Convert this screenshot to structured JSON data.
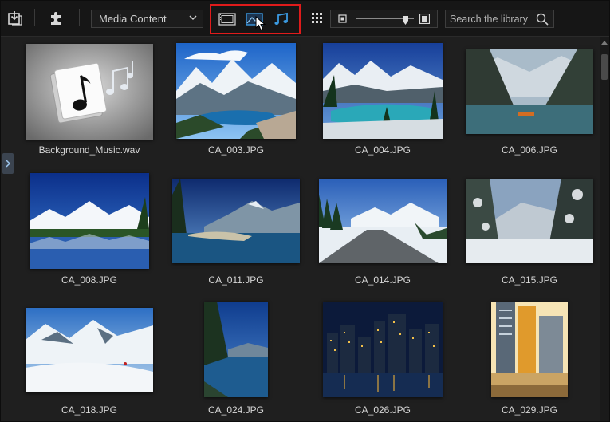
{
  "toolbar": {
    "icons": {
      "import": "import-media-icon",
      "plugin": "puzzle-plugin-icon",
      "dropdown_chevron": "chevron-down-icon",
      "filter_video": "film-filter-icon",
      "filter_image": "image-filter-icon",
      "filter_audio": "music-filter-icon",
      "grid": "grid-view-icon",
      "zoom_small": "zoom-small-icon",
      "zoom_large": "zoom-large-icon",
      "search": "magnifier-icon",
      "cursor": "mouse-pointer-icon"
    },
    "content_dropdown": {
      "selected": "Media Content"
    },
    "search": {
      "placeholder": "Search the library",
      "value": ""
    },
    "zoom_slider": {
      "level": 0.85
    },
    "active_filter": "image"
  },
  "colors": {
    "accent_blue": "#3b9ae1",
    "highlight_red": "#e01b1b",
    "panel_bg": "#1f1f1f",
    "toolbar_bg": "#161616",
    "label_text": "#d6d6d6"
  },
  "sidebar": {
    "expand_icon": "chevron-right-icon"
  },
  "library": {
    "items": [
      {
        "file_name": "Background_Music.wav",
        "kind": "audio"
      },
      {
        "file_name": "CA_003.JPG",
        "kind": "image"
      },
      {
        "file_name": "CA_004.JPG",
        "kind": "image"
      },
      {
        "file_name": "CA_006.JPG",
        "kind": "image"
      },
      {
        "file_name": "CA_008.JPG",
        "kind": "image"
      },
      {
        "file_name": "CA_011.JPG",
        "kind": "image"
      },
      {
        "file_name": "CA_014.JPG",
        "kind": "image"
      },
      {
        "file_name": "CA_015.JPG",
        "kind": "image"
      },
      {
        "file_name": "CA_018.JPG",
        "kind": "image"
      },
      {
        "file_name": "CA_024.JPG",
        "kind": "image"
      },
      {
        "file_name": "CA_026.JPG",
        "kind": "image"
      },
      {
        "file_name": "CA_029.JPG",
        "kind": "image"
      }
    ]
  }
}
